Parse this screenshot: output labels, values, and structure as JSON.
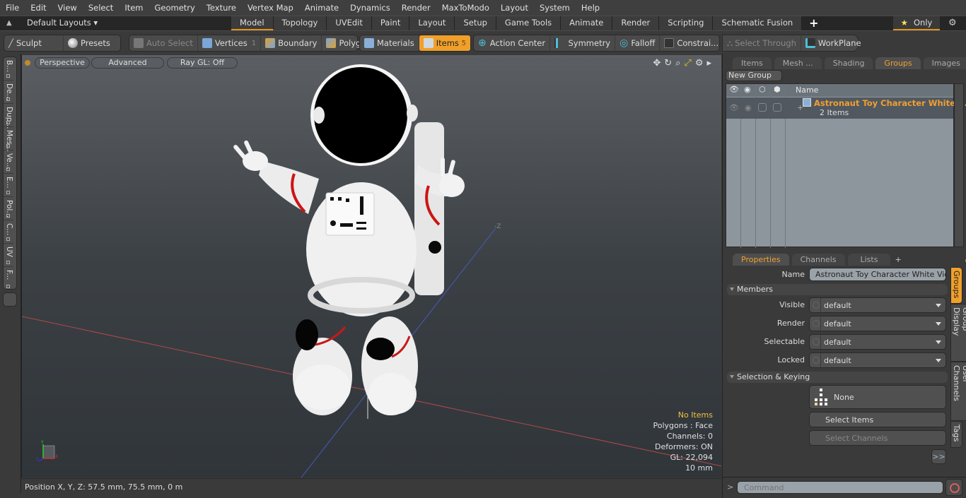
{
  "menubar": [
    "File",
    "Edit",
    "View",
    "Select",
    "Item",
    "Geometry",
    "Texture",
    "Vertex Map",
    "Animate",
    "Dynamics",
    "Render",
    "MaxToModo",
    "Layout",
    "System",
    "Help"
  ],
  "layoutbar": {
    "default_layouts": "Default Layouts",
    "tabs": [
      "Model",
      "Topology",
      "UVEdit",
      "Paint",
      "Layout",
      "Setup",
      "Game Tools",
      "Animate",
      "Render",
      "Scripting",
      "Schematic Fusion"
    ],
    "active_tab": "Model",
    "add_label": "+",
    "only_label": "Only"
  },
  "toolbar": {
    "sculpt": "Sculpt",
    "presets": "Presets",
    "auto_select": "Auto Select",
    "vertices": "Vertices",
    "vertices_count": "1",
    "boundary": "Boundary",
    "polygons": "Polygons",
    "materials": "Materials",
    "items": "Items",
    "items_count": "5",
    "action_center": "Action Center",
    "symmetry": "Symmetry",
    "falloff": "Falloff",
    "constraints": "Constrai...",
    "select_through": "Select Through",
    "workplane": "WorkPlane"
  },
  "left_tabs": [
    "B...",
    "De...",
    "Dup...",
    "Mes...",
    "Ve...",
    "E...",
    "Pol...",
    "C...",
    "UV",
    "F..."
  ],
  "viewport": {
    "view_mode": "Perspective",
    "shading": "Advanced",
    "raygl": "Ray GL: Off",
    "stats": {
      "selection": "No Items",
      "polygons": "Polygons : Face",
      "channels": "Channels: 0",
      "deformers": "Deformers: ON",
      "gl": "GL: 22,094",
      "grid": "10 mm"
    },
    "axis_label": "-Z"
  },
  "statusbar": {
    "position": "Position X, Y, Z:   57.5 mm, 75.5 mm, 0 m"
  },
  "groups_panel": {
    "tabs": [
      "Items",
      "Mesh ...",
      "Shading",
      "Groups",
      "Images"
    ],
    "active_tab": "Groups",
    "new_group": "New Group",
    "column_name": "Name",
    "group": {
      "name": "Astronaut Toy Character White ...",
      "count": "2 Items"
    }
  },
  "properties_panel": {
    "tabs": [
      "Properties",
      "Channels",
      "Lists"
    ],
    "active_tab": "Properties",
    "name_label": "Name",
    "name_value": "Astronaut Toy Character White Victor",
    "members_section": "Members",
    "fields": [
      {
        "label": "Visible",
        "value": "default"
      },
      {
        "label": "Render",
        "value": "default"
      },
      {
        "label": "Selectable",
        "value": "default"
      },
      {
        "label": "Locked",
        "value": "default"
      }
    ],
    "selection_section": "Selection & Keying",
    "none_label": "None",
    "select_items": "Select Items",
    "select_channels": "Select Channels",
    "more": ">>",
    "side_tabs": [
      "Groups",
      "Group Display",
      "User Channels",
      "Tags"
    ]
  },
  "command": {
    "prompt": ">",
    "placeholder": "Command"
  },
  "colors": {
    "accent": "#f0a02a",
    "group_name": "#f0a030",
    "stat_highlight": "#f0c040"
  }
}
